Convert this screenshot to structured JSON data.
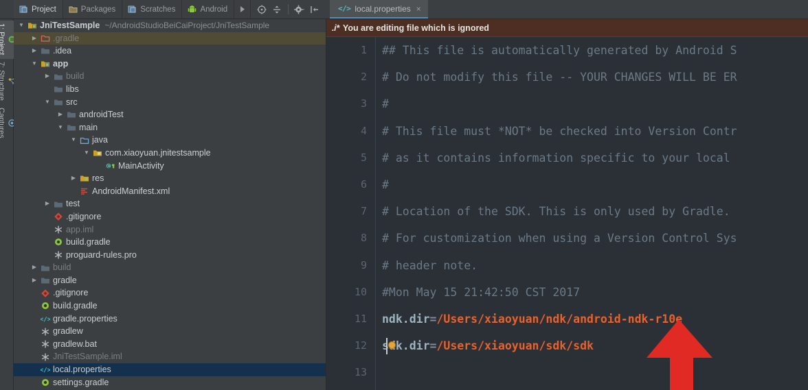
{
  "window": {
    "app": "Android Studio"
  },
  "left_rail": {
    "items": [
      {
        "label": "1: Project",
        "icon": "project-icon",
        "active": true
      },
      {
        "label": "7: Structure",
        "icon": "structure-icon",
        "active": false
      },
      {
        "label": "Captures",
        "icon": "captures-icon",
        "active": false
      }
    ]
  },
  "toolwindow_tabs": {
    "tabs": [
      {
        "label": "Project",
        "icon": "project-view-icon",
        "active": true
      },
      {
        "label": "Packages",
        "icon": "packages-icon",
        "active": false
      },
      {
        "label": "Scratches",
        "icon": "scratches-icon",
        "active": false
      },
      {
        "label": "Android",
        "icon": "android-robot-icon",
        "active": false
      }
    ],
    "overflow_label": "▶",
    "actions": [
      {
        "name": "scroll-from-source-icon",
        "title": "Scroll from Source"
      },
      {
        "name": "collapse-all-icon",
        "title": "Collapse All"
      },
      {
        "name": "settings-gear-icon",
        "title": "Settings"
      },
      {
        "name": "hide-icon",
        "title": "Hide"
      }
    ]
  },
  "editor_tab": {
    "label": "local.properties",
    "icon": "properties-file-icon",
    "close": "×"
  },
  "project_tree": {
    "root": {
      "name": "JniTestSample",
      "path": "~/AndroidStudioBeiCaiProject/JniTestSample"
    },
    "rows": [
      {
        "depth": 0,
        "twisty": "down",
        "icon": "module-icon",
        "label": "JniTestSample",
        "path": "~/AndroidStudioBeiCaiProject/JniTestSample",
        "bold": true,
        "state": "none"
      },
      {
        "depth": 1,
        "twisty": "right",
        "icon": "folder-red-icon",
        "label": ".gradle",
        "dim": true,
        "state": "hover"
      },
      {
        "depth": 1,
        "twisty": "right",
        "icon": "folder-icon",
        "label": ".idea",
        "state": "none"
      },
      {
        "depth": 1,
        "twisty": "down",
        "icon": "module-icon",
        "label": "app",
        "bold": true,
        "state": "none"
      },
      {
        "depth": 2,
        "twisty": "right",
        "icon": "folder-icon",
        "label": "build",
        "dim": true,
        "state": "none"
      },
      {
        "depth": 2,
        "twisty": "none",
        "icon": "folder-icon",
        "label": "libs",
        "state": "none"
      },
      {
        "depth": 2,
        "twisty": "down",
        "icon": "folder-icon",
        "label": "src",
        "state": "none"
      },
      {
        "depth": 3,
        "twisty": "right",
        "icon": "folder-icon",
        "label": "androidTest",
        "state": "none"
      },
      {
        "depth": 3,
        "twisty": "down",
        "icon": "folder-icon",
        "label": "main",
        "state": "none"
      },
      {
        "depth": 4,
        "twisty": "down",
        "icon": "source-root-icon",
        "label": "java",
        "state": "none"
      },
      {
        "depth": 5,
        "twisty": "down",
        "icon": "package-icon",
        "label": "com.xiaoyuan.jnitestsample",
        "state": "none"
      },
      {
        "depth": 6,
        "twisty": "none",
        "icon": "java-class-icon",
        "label": "MainActivity",
        "state": "none"
      },
      {
        "depth": 4,
        "twisty": "right",
        "icon": "res-folder-icon",
        "label": "res",
        "state": "none"
      },
      {
        "depth": 4,
        "twisty": "none",
        "icon": "manifest-icon",
        "label": "AndroidManifest.xml",
        "state": "none"
      },
      {
        "depth": 2,
        "twisty": "right",
        "icon": "folder-icon",
        "label": "test",
        "state": "none"
      },
      {
        "depth": 2,
        "twisty": "none",
        "icon": "gitignore-icon",
        "label": ".gitignore",
        "state": "none"
      },
      {
        "depth": 2,
        "twisty": "none",
        "icon": "iml-icon",
        "label": "app.iml",
        "dim": true,
        "state": "none"
      },
      {
        "depth": 2,
        "twisty": "none",
        "icon": "gradle-icon",
        "label": "build.gradle",
        "state": "none"
      },
      {
        "depth": 2,
        "twisty": "none",
        "icon": "iml-icon",
        "label": "proguard-rules.pro",
        "state": "none"
      },
      {
        "depth": 1,
        "twisty": "right",
        "icon": "folder-icon",
        "label": "build",
        "dim": true,
        "state": "none"
      },
      {
        "depth": 1,
        "twisty": "right",
        "icon": "folder-icon",
        "label": "gradle",
        "state": "none"
      },
      {
        "depth": 1,
        "twisty": "none",
        "icon": "gitignore-icon",
        "label": ".gitignore",
        "state": "none"
      },
      {
        "depth": 1,
        "twisty": "none",
        "icon": "gradle-icon",
        "label": "build.gradle",
        "state": "none"
      },
      {
        "depth": 1,
        "twisty": "none",
        "icon": "properties-file-icon",
        "label": "gradle.properties",
        "state": "none"
      },
      {
        "depth": 1,
        "twisty": "none",
        "icon": "iml-icon",
        "label": "gradlew",
        "state": "none"
      },
      {
        "depth": 1,
        "twisty": "none",
        "icon": "iml-icon",
        "label": "gradlew.bat",
        "state": "none"
      },
      {
        "depth": 1,
        "twisty": "none",
        "icon": "iml-icon",
        "label": "JniTestSample.iml",
        "dim": true,
        "state": "none"
      },
      {
        "depth": 1,
        "twisty": "none",
        "icon": "properties-file-icon",
        "label": "local.properties",
        "state": "selected"
      },
      {
        "depth": 1,
        "twisty": "none",
        "icon": "gradle-icon",
        "label": "settings.gradle",
        "state": "none"
      }
    ]
  },
  "notification": {
    "prefix": ".i*",
    "text": "You are editing file which is ignored"
  },
  "editor": {
    "filename": "local.properties",
    "lines": [
      {
        "num": "1",
        "type": "comment",
        "text": "## This file is automatically generated by Android S"
      },
      {
        "num": "2",
        "type": "comment",
        "text": "# Do not modify this file -- YOUR CHANGES WILL BE ER"
      },
      {
        "num": "3",
        "type": "comment",
        "text": "#"
      },
      {
        "num": "4",
        "type": "comment",
        "text": "# This file must *NOT* be checked into Version Contr"
      },
      {
        "num": "5",
        "type": "comment",
        "text": "# as it contains information specific to your local "
      },
      {
        "num": "6",
        "type": "comment",
        "text": "#"
      },
      {
        "num": "7",
        "type": "comment",
        "text": "# Location of the SDK. This is only used by Gradle. "
      },
      {
        "num": "8",
        "type": "comment",
        "text": "# For customization when using a Version Control Sys"
      },
      {
        "num": "9",
        "type": "comment",
        "text": "# header note."
      },
      {
        "num": "10",
        "type": "comment",
        "text": "#Mon May 15 21:42:50 CST 2017"
      },
      {
        "num": "11",
        "type": "property",
        "key": "ndk.dir",
        "eq": "=",
        "value": "/Users/xiaoyuan/ndk/android-ndk-r10e"
      },
      {
        "num": "12",
        "type": "property",
        "key": "sdk.dir",
        "eq": "=",
        "value": "/Users/xiaoyuan/sdk/sdk",
        "bulb": true,
        "caret": true
      },
      {
        "num": "13",
        "type": "blank",
        "text": ""
      }
    ]
  },
  "annotation": {
    "arrow": "red-up-arrow",
    "color": "#e02a23"
  },
  "colors": {
    "panel_bg": "#3c3f41",
    "editor_bg": "#2b2f36",
    "notification_bg": "#4d2e22",
    "selection_bg": "#13304d",
    "hover_bg": "#4f4b35",
    "value_orange": "#e8622c",
    "comment_grey": "#6b7a86",
    "tab_underline": "#4a8fbd",
    "arrow_red": "#e02a23"
  }
}
